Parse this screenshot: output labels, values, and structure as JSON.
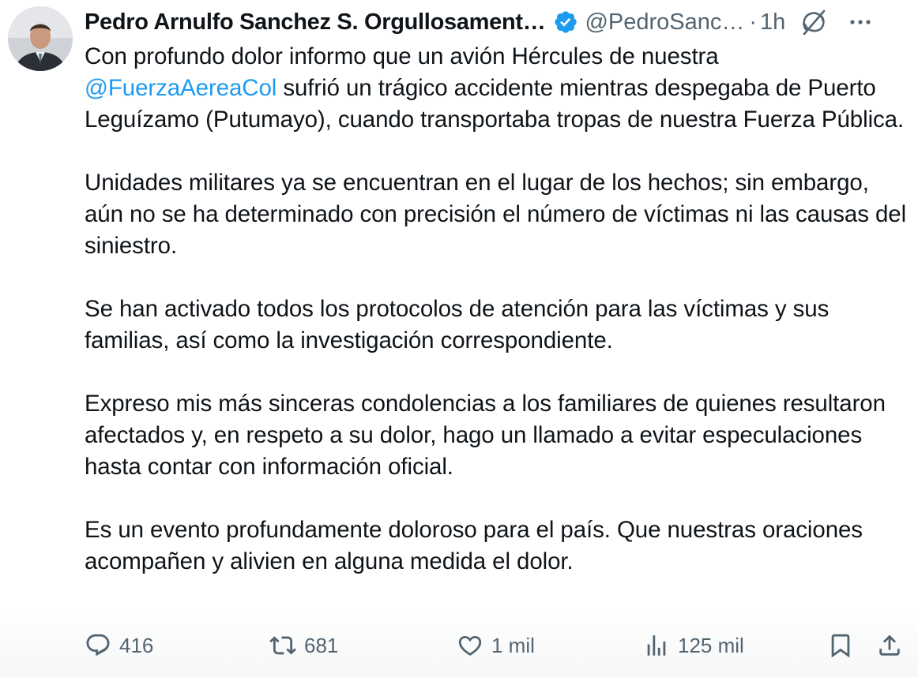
{
  "author": {
    "display_name": "Pedro Arnulfo Sanchez S. Orgullosament…",
    "handle": "@PedroSanc…",
    "separator": "·",
    "time": "1h"
  },
  "icons": {
    "verified": "verified-badge-icon",
    "grok": "grok-icon",
    "more": "more-icon",
    "reply": "reply-icon",
    "repost": "repost-icon",
    "like": "heart-icon",
    "views": "views-icon",
    "bookmark": "bookmark-icon",
    "share": "share-icon"
  },
  "colors": {
    "accent": "#1d9bf0",
    "text": "#0f1419",
    "secondary": "#536471"
  },
  "tweet": {
    "p1_before": "Con profundo dolor informo que un avión Hércules de nuestra ",
    "p1_mention": "@FuerzaAereaCol",
    "p1_after": " sufrió un trágico accidente mientras despegaba de Puerto Leguízamo (Putumayo), cuando transportaba tropas de nuestra Fuerza Pública.",
    "p2": "Unidades militares ya se encuentran en el lugar de los hechos; sin embargo, aún no se ha determinado con precisión el número de víctimas ni las causas del siniestro.",
    "p3": "Se han activado todos los protocolos de atención para las víctimas y sus familias, así como la investigación correspondiente.",
    "p4": "Expreso mis más sinceras condolencias a los familiares de quienes resultaron afectados y, en respeto a su dolor, hago un llamado a evitar especulaciones hasta contar con información oficial.",
    "p5": "Es un evento profundamente doloroso para el país. Que nuestras oraciones acompañen y alivien en alguna medida el dolor."
  },
  "stats": {
    "replies": "416",
    "reposts": "681",
    "likes": "1 mil",
    "views": "125 mil"
  }
}
